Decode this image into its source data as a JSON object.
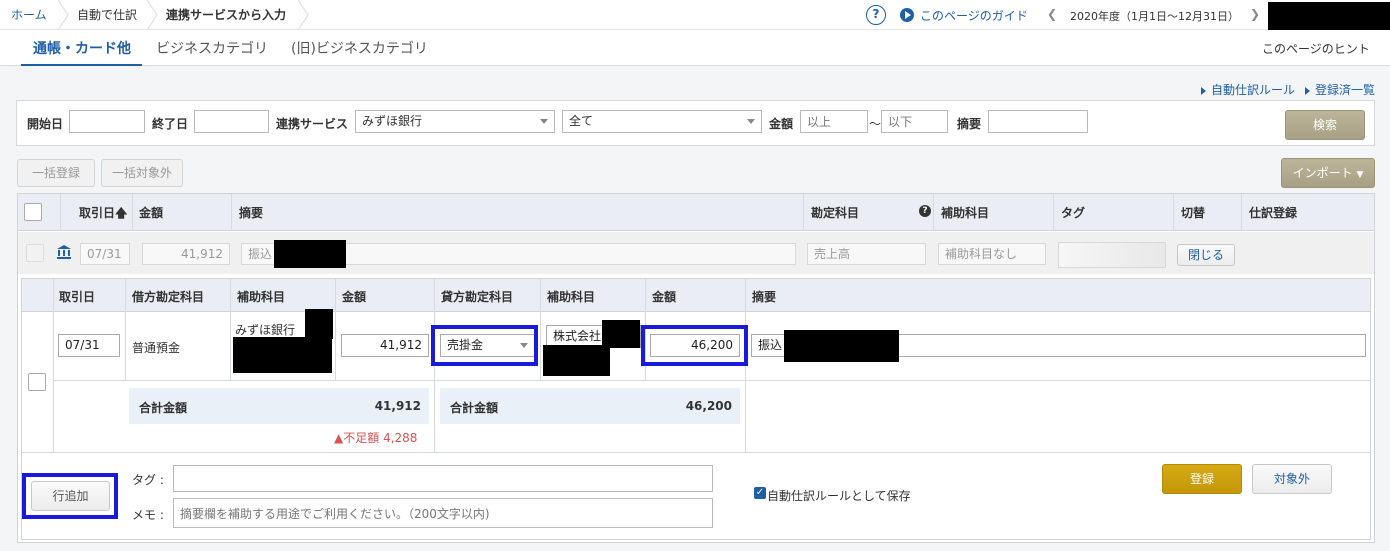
{
  "breadcrumb": {
    "home": "ホーム",
    "auto": "自動で仕訳",
    "current": "連携サービスから入力"
  },
  "header": {
    "guide": "このページのガイド",
    "fiscal_year": "2020年度（1月1日〜12月31日）"
  },
  "tabs": {
    "tab1": "通帳・カード他",
    "tab2": "ビジネスカテゴリ",
    "tab3": "(旧)ビジネスカテゴリ",
    "hint": "このページのヒント"
  },
  "links": {
    "auto_rules": "自動仕訳ルール",
    "registered": "登録済一覧"
  },
  "search": {
    "start_label": "開始日",
    "end_label": "終了日",
    "service_label": "連携サービス",
    "service_value": "みずほ銀行",
    "filter_value": "全て",
    "amount_label": "金額",
    "min_placeholder": "以上",
    "tilde": "〜",
    "max_placeholder": "以下",
    "summary_label": "摘要",
    "search_button": "検索"
  },
  "toolbar": {
    "bulk_register": "一括登録",
    "bulk_exclude": "一括対象外",
    "import": "インポート"
  },
  "table_header": {
    "date": "取引日",
    "amount": "金額",
    "summary": "摘要",
    "account": "勘定科目",
    "sub_account": "補助科目",
    "tag": "タグ",
    "toggle": "切替",
    "journal": "仕訳登録"
  },
  "row": {
    "date": "07/31",
    "amount": "41,912",
    "summary": "振込",
    "account": "売上高",
    "sub_account": "補助科目なし",
    "close_button": "閉じる"
  },
  "detail_header": {
    "date": "取引日",
    "debit_account": "借方勘定科目",
    "debit_sub": "補助科目",
    "debit_amount": "金額",
    "credit_account": "貸方勘定科目",
    "credit_sub": "補助科目",
    "credit_amount": "金額",
    "summary": "摘要"
  },
  "detail": {
    "date": "07/31",
    "debit_account": "普通預金",
    "debit_sub": "みずほ銀行",
    "debit_amount": "41,912",
    "credit_account": "売掛金",
    "credit_sub": "株式会社",
    "credit_amount": "46,200",
    "summary": "振込"
  },
  "totals": {
    "label": "合計金額",
    "debit_total": "41,912",
    "credit_total": "46,200",
    "shortage_label": "不足額",
    "shortage_value": "4,288"
  },
  "footer": {
    "add_row": "行追加",
    "tag_label": "タグ :",
    "memo_label": "メモ :",
    "memo_placeholder": "摘要欄を補助する用途でご利用ください。（200文字以内)",
    "save_rule": "自動仕訳ルールとして保存",
    "register": "登録",
    "exclude": "対象外"
  },
  "colors": {
    "accent": "#1f5fa8",
    "highlight": "#1a1adb",
    "warning": "#d9534f",
    "gold": "#c39708"
  }
}
